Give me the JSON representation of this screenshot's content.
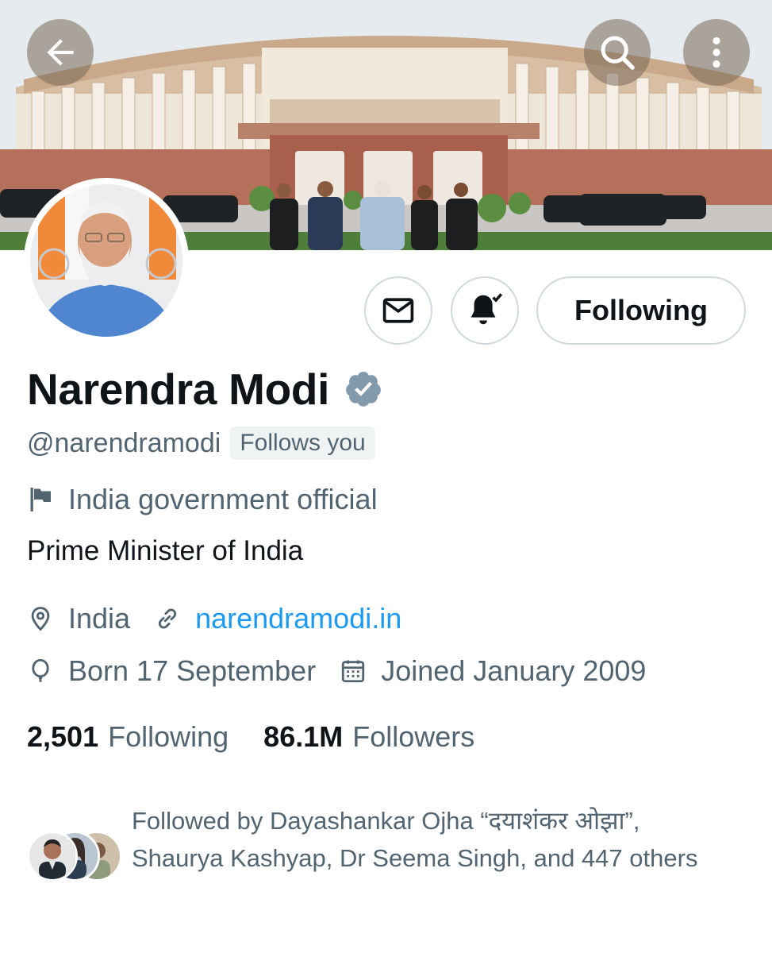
{
  "header": {
    "back_icon": "arrow-left-icon",
    "search_icon": "search-icon",
    "more_icon": "more-vertical-icon"
  },
  "actions": {
    "message_icon": "envelope-icon",
    "notifications_icon": "bell-check-icon",
    "follow_label": "Following"
  },
  "profile": {
    "name": "Narendra Modi",
    "handle": "@narendramodi",
    "follows_you": "Follows you",
    "label": "India government official",
    "bio": "Prime Minister of India",
    "location": "India",
    "website": "narendramodi.in",
    "birthday": "Born 17 September",
    "joined": "Joined January 2009",
    "following_count": "2,501",
    "following_label": "Following",
    "followers_count": "86.1M",
    "followers_label": "Followers",
    "followed_by": "Followed by Dayashankar Ojha “दयाशंकर ओझा”, Shaurya Kashyap, Dr Seema Singh, and 447 others"
  },
  "colors": {
    "text_primary": "#0f1419",
    "text_secondary": "#536471",
    "link": "#1d9bf0",
    "border": "#cfd9de",
    "verified_badge": "#829aab"
  }
}
